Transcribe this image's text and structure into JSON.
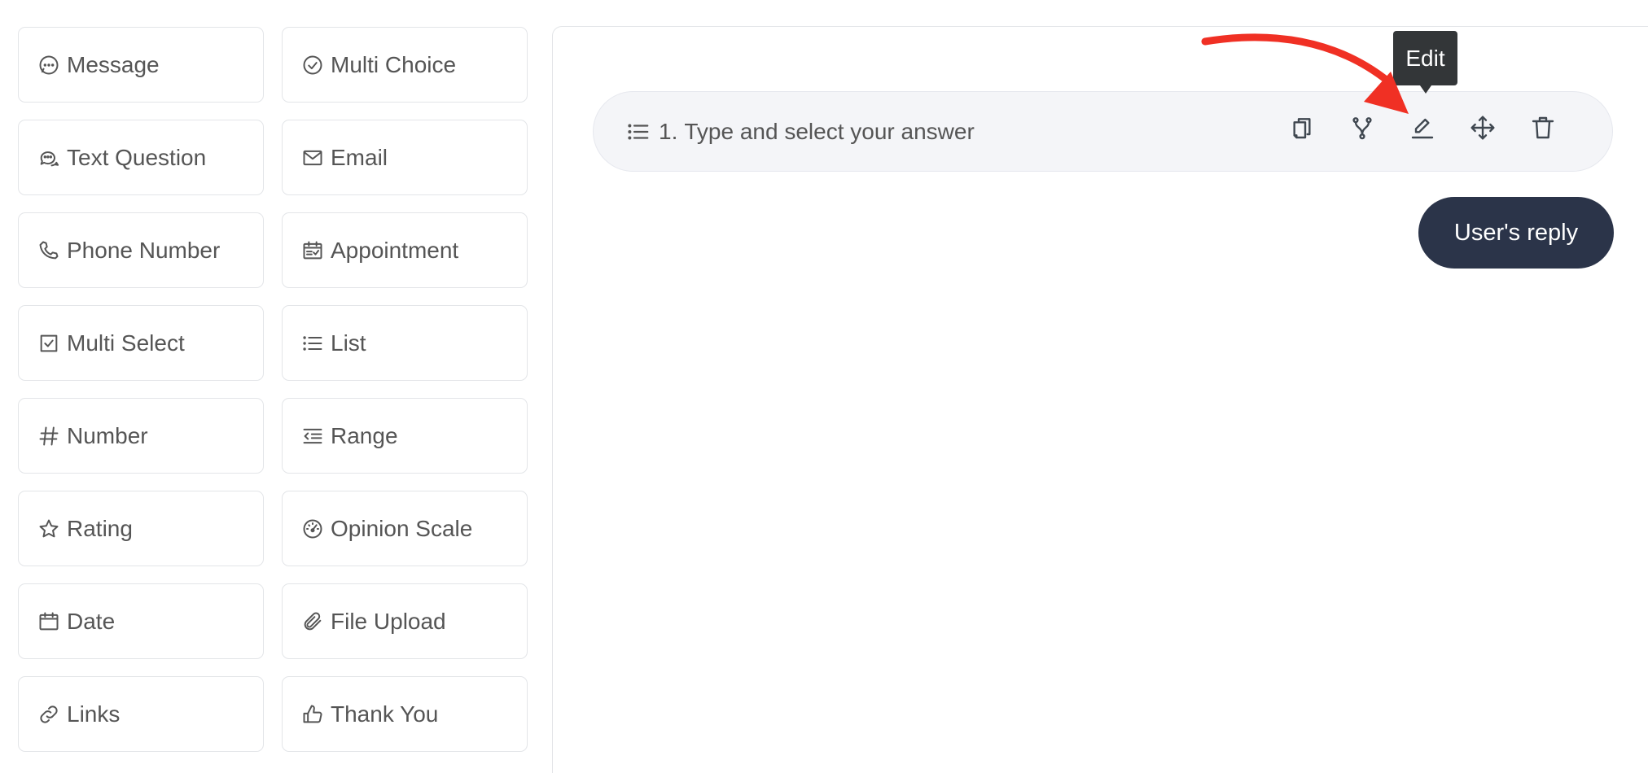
{
  "palette": {
    "blocks": [
      {
        "label": "Message",
        "icon": "chat-bubble-icon"
      },
      {
        "label": "Multi Choice",
        "icon": "check-circle-icon"
      },
      {
        "label": "Text Question",
        "icon": "chat-bubbles-icon"
      },
      {
        "label": "Email",
        "icon": "envelope-icon"
      },
      {
        "label": "Phone Number",
        "icon": "phone-icon"
      },
      {
        "label": "Appointment",
        "icon": "calendar-event-icon"
      },
      {
        "label": "Multi Select",
        "icon": "checkbox-icon"
      },
      {
        "label": "List",
        "icon": "list-icon"
      },
      {
        "label": "Number",
        "icon": "hashtag-icon"
      },
      {
        "label": "Range",
        "icon": "range-icon"
      },
      {
        "label": "Rating",
        "icon": "star-icon"
      },
      {
        "label": "Opinion Scale",
        "icon": "gauge-icon"
      },
      {
        "label": "Date",
        "icon": "calendar-icon"
      },
      {
        "label": "File Upload",
        "icon": "paperclip-icon"
      },
      {
        "label": "Links",
        "icon": "link-icon"
      },
      {
        "label": "Thank You",
        "icon": "thumbs-up-icon"
      }
    ]
  },
  "question": {
    "number": "1.",
    "text": "Type and select your answer",
    "icon": "list-icon"
  },
  "actions": [
    {
      "name": "duplicate",
      "icon": "copy-icon"
    },
    {
      "name": "branch",
      "icon": "branch-icon"
    },
    {
      "name": "edit",
      "icon": "pencil-icon"
    },
    {
      "name": "move",
      "icon": "move-icon"
    },
    {
      "name": "delete",
      "icon": "trash-icon"
    }
  ],
  "tooltip": {
    "text": "Edit"
  },
  "reply": {
    "label": "User's reply"
  },
  "colors": {
    "accent_dark": "#2b3449",
    "arrow": "#f03024",
    "tooltip_bg": "#333638"
  }
}
